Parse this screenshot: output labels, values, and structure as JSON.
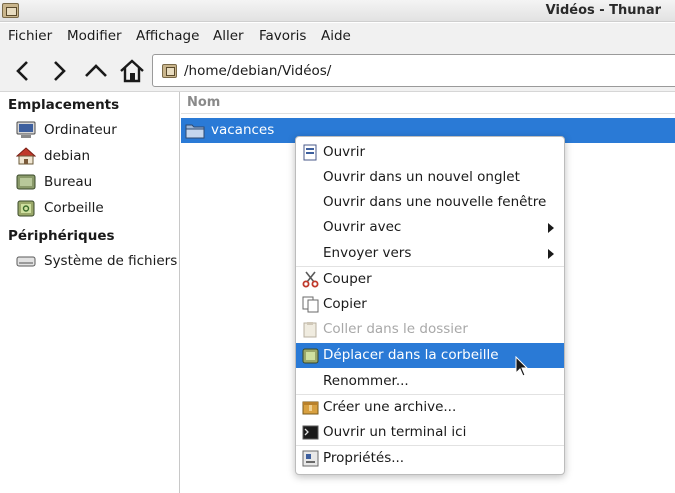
{
  "window": {
    "title": "Vidéos - Thunar"
  },
  "menubar": {
    "items": [
      "Fichier",
      "Modifier",
      "Affichage",
      "Aller",
      "Favoris",
      "Aide"
    ]
  },
  "toolbar": {
    "buttons": [
      "back-icon",
      "forward-icon",
      "up-icon",
      "home-icon"
    ],
    "path": "/home/debian/Vidéos/"
  },
  "sidebar": {
    "places_heading": "Emplacements",
    "places": [
      {
        "label": "Ordinateur",
        "icon": "computer-icon"
      },
      {
        "label": "debian",
        "icon": "user-home-icon"
      },
      {
        "label": "Bureau",
        "icon": "desktop-icon"
      },
      {
        "label": "Corbeille",
        "icon": "trash-icon"
      }
    ],
    "devices_heading": "Périphériques",
    "devices": [
      {
        "label": "Système de fichiers",
        "icon": "drive-icon"
      }
    ]
  },
  "main": {
    "column_header": "Nom",
    "files": [
      {
        "name": "vacances",
        "icon": "folder-icon",
        "selected": true
      }
    ]
  },
  "context_menu": {
    "items": [
      {
        "label": "Ouvrir",
        "icon": "open-icon"
      },
      {
        "label": "Ouvrir dans un nouvel onglet"
      },
      {
        "label": "Ouvrir dans une nouvelle fenêtre"
      },
      {
        "label": "Ouvrir avec",
        "submenu": true
      },
      {
        "label": "Envoyer vers",
        "submenu": true
      },
      {
        "label": "Couper",
        "icon": "scissors-icon"
      },
      {
        "label": "Copier",
        "icon": "copy-icon"
      },
      {
        "label": "Coller dans le dossier",
        "icon": "paste-icon",
        "disabled": true
      },
      {
        "label": "Déplacer dans la corbeille",
        "icon": "trash-icon",
        "highlighted": true
      },
      {
        "label": "Renommer..."
      },
      {
        "label": "Créer une archive...",
        "icon": "archive-icon"
      },
      {
        "label": "Ouvrir un terminal ici",
        "icon": "terminal-icon"
      },
      {
        "label": "Propriétés...",
        "icon": "properties-icon"
      }
    ]
  },
  "colors": {
    "selection": "#2a7ad6",
    "background": "#ffffff",
    "chrome": "#f1f1f1"
  }
}
